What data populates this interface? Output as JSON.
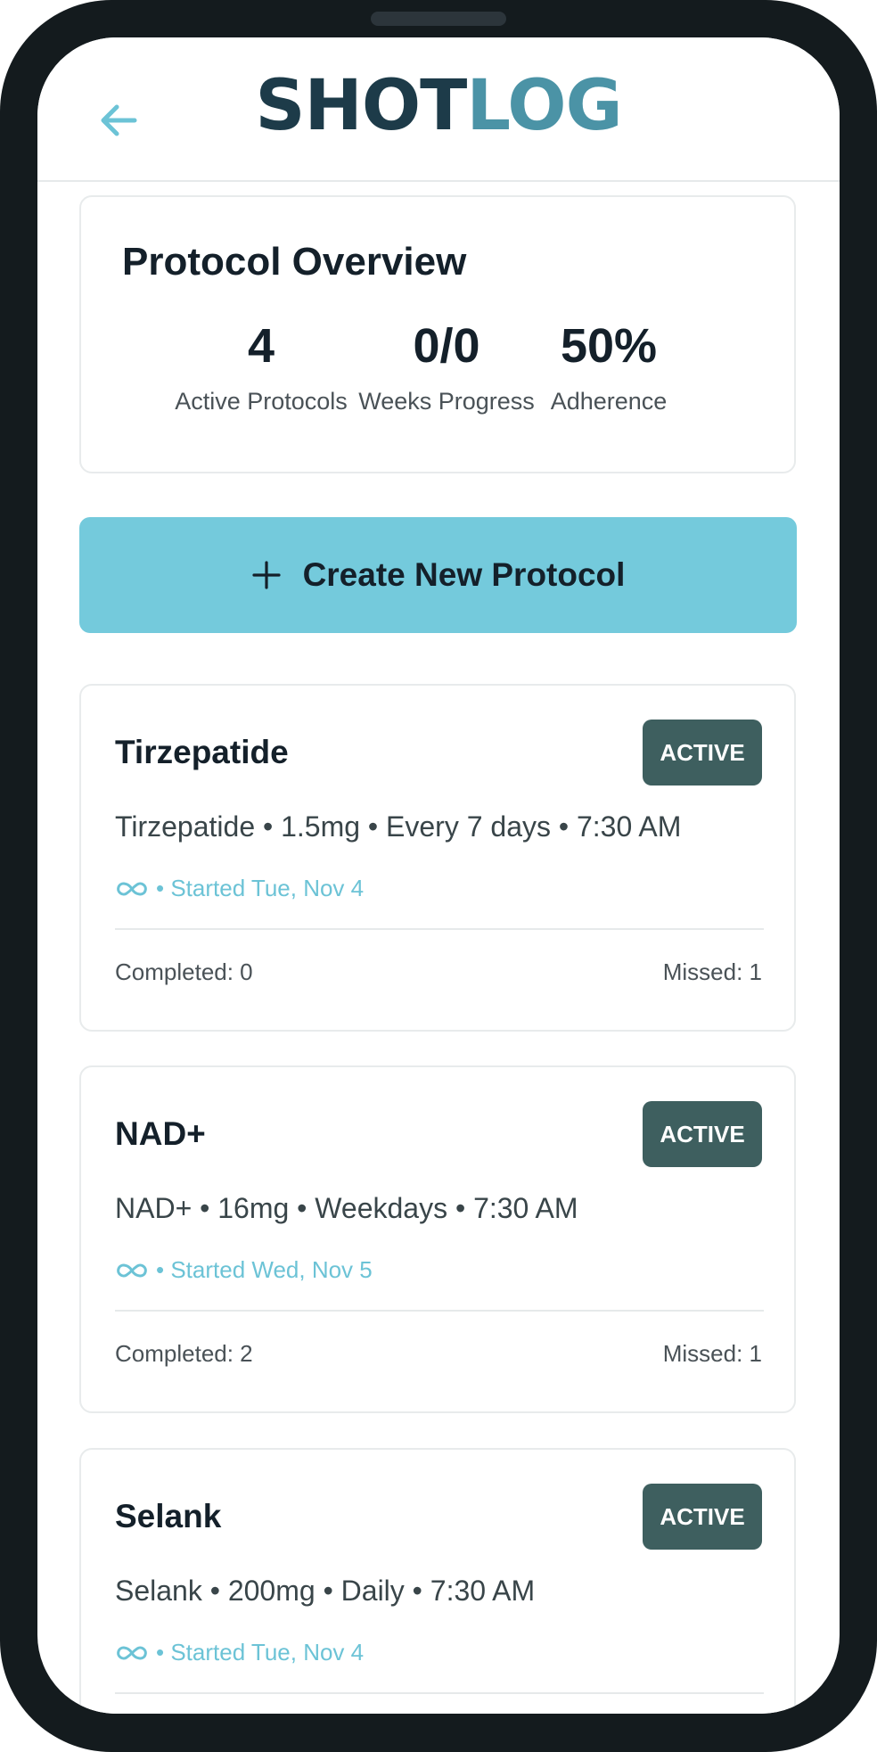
{
  "header": {
    "logo_dark": "SHOT",
    "logo_light": "LOG",
    "back_icon": "arrow-left-icon"
  },
  "overview": {
    "title": "Protocol Overview",
    "stats": [
      {
        "value": "4",
        "label": "Active Protocols"
      },
      {
        "value": "0/0",
        "label": "Weeks Progress"
      },
      {
        "value": "50%",
        "label": "Adherence"
      }
    ]
  },
  "create_button": {
    "icon": "plus-icon",
    "label": "Create New Protocol"
  },
  "protocols": [
    {
      "name": "Tirzepatide",
      "status": "ACTIVE",
      "detail": "Tirzepatide • 1.5mg • Every 7 days • 7:30 AM",
      "started": "• Started Tue, Nov 4",
      "completed": "Completed: 0",
      "missed": "Missed: 1"
    },
    {
      "name": "NAD+",
      "status": "ACTIVE",
      "detail": "NAD+ • 16mg • Weekdays • 7:30 AM",
      "started": "• Started Wed, Nov 5",
      "completed": "Completed: 2",
      "missed": "Missed: 1"
    },
    {
      "name": "Selank",
      "status": "ACTIVE",
      "detail": "Selank • 200mg • Daily • 7:30 AM",
      "started": "• Started Tue, Nov 4",
      "completed": "",
      "missed": ""
    }
  ],
  "colors": {
    "accent": "#74cadc",
    "badge": "#3e5f5f",
    "logo_dark": "#1d3b49",
    "logo_light": "#4b93a6"
  }
}
